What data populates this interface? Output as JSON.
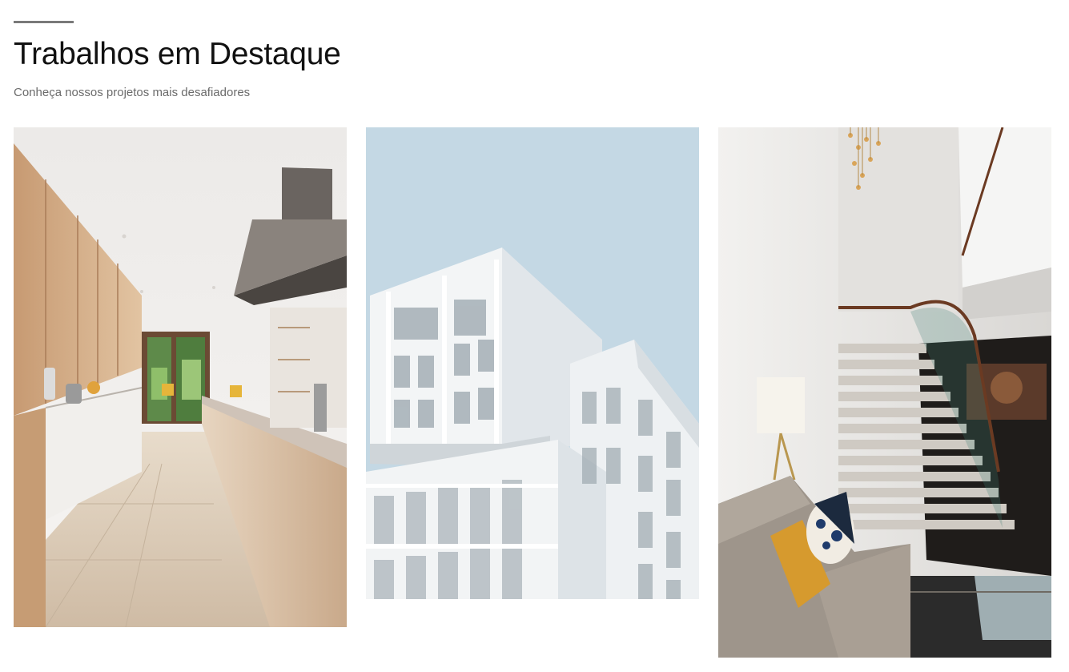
{
  "header": {
    "title": "Trabalhos em Destaque",
    "subtitle": "Conheça nossos projetos mais desafiadores",
    "accent_color": "#7a7a7a"
  },
  "projects": [
    {
      "subject": "kitchen-interior"
    },
    {
      "subject": "white-modern-building"
    },
    {
      "subject": "lobby-staircase"
    }
  ]
}
